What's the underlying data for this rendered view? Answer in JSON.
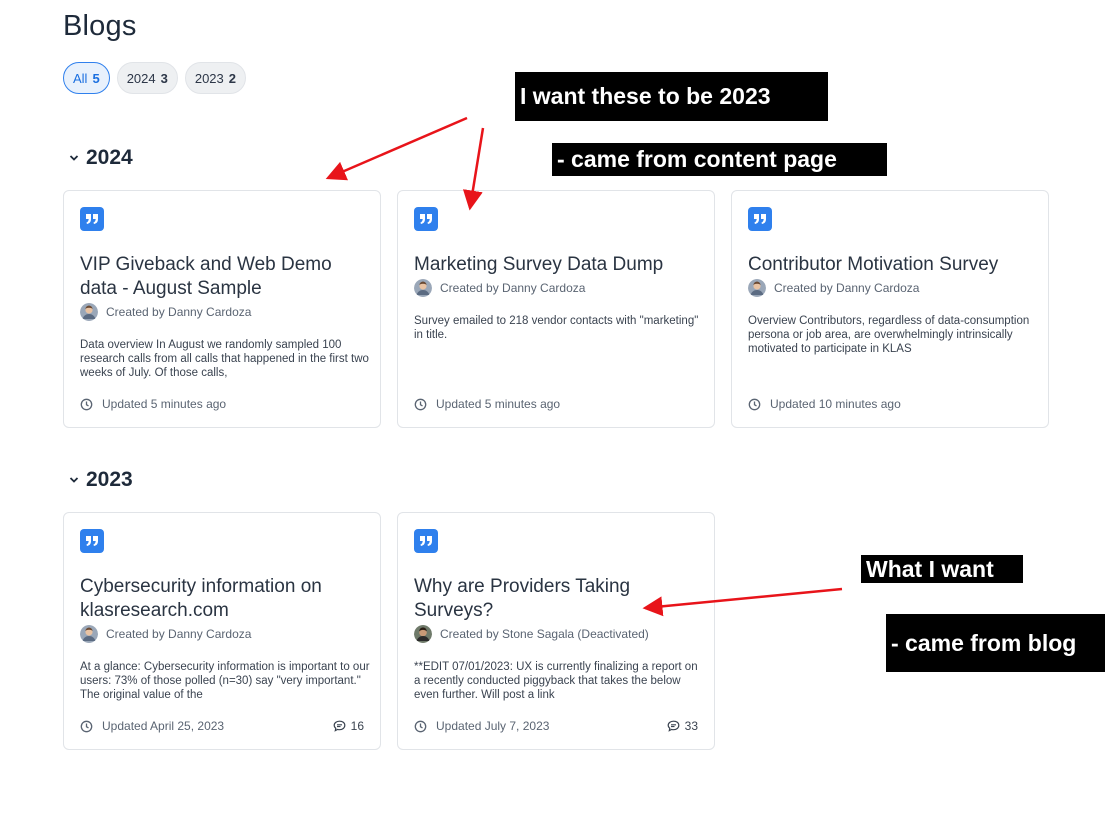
{
  "page": {
    "title": "Blogs"
  },
  "filters": [
    {
      "label": "All",
      "count": "5",
      "active": true
    },
    {
      "label": "2024",
      "count": "3",
      "active": false
    },
    {
      "label": "2023",
      "count": "2",
      "active": false
    }
  ],
  "sections": [
    {
      "year": "2024",
      "cards": [
        {
          "title": "VIP Giveback and Web Demo data - August Sample",
          "author": "Created by Danny Cardoza",
          "excerpt": "Data overview In August we randomly sampled 100 research calls from all calls that happened in the first two weeks of July. Of those calls,",
          "updated": "Updated 5 minutes ago"
        },
        {
          "title": "Marketing Survey Data Dump",
          "author": "Created by Danny Cardoza",
          "excerpt": "Survey emailed to 218 vendor contacts with \"marketing\" in title.",
          "updated": "Updated 5 minutes ago"
        },
        {
          "title": "Contributor Motivation Survey",
          "author": "Created by Danny Cardoza",
          "excerpt": "Overview Contributors, regardless of data-consumption persona or job area, are overwhelmingly intrinsically motivated to participate in KLAS",
          "updated": "Updated 10 minutes ago"
        }
      ]
    },
    {
      "year": "2023",
      "cards": [
        {
          "title": "Cybersecurity information on klasresearch.com",
          "author": "Created by Danny Cardoza",
          "excerpt": "At a glance: Cybersecurity information is important to our users: 73% of those polled (n=30) say \"very important.\" The original value of the",
          "updated": "Updated April 25, 2023",
          "comments": "16"
        },
        {
          "title": "Why are Providers Taking Surveys?",
          "author": "Created by Stone Sagala (Deactivated)",
          "excerpt": "**EDIT 07/01/2023: UX is currently finalizing a report on a recently conducted piggyback that takes the below even further. Will post a link",
          "updated": "Updated July 7, 2023",
          "comments": "33"
        }
      ]
    }
  ],
  "annotations": {
    "want_2023": "I want these to be 2023",
    "content_page": "- came from content page",
    "what_i_want": "What I want",
    "came_from_blog": "- came from blog"
  },
  "colors": {
    "accent": "#2f80ed",
    "arrow": "#e8141a"
  }
}
